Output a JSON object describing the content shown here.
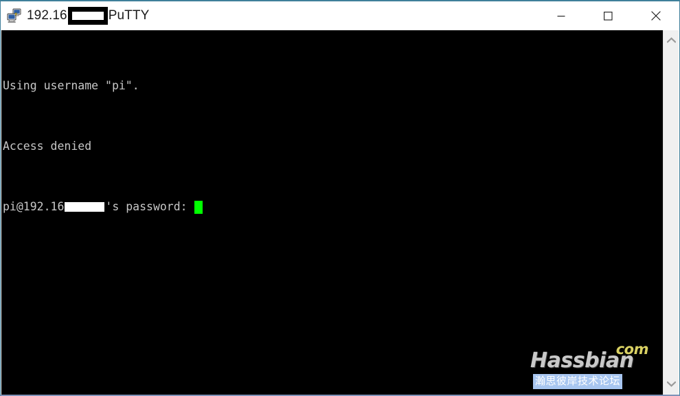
{
  "window": {
    "title_prefix": "192.16",
    "title_redacted": true,
    "title_suffix": "PuTTY",
    "app_icon_name": "putty-computers-icon",
    "frame_top_color": "#3f7f9a",
    "frame_bottom_color": "#7f92b8"
  },
  "window_controls": {
    "minimize_label": "Minimize",
    "maximize_label": "Maximize",
    "close_label": "Close"
  },
  "terminal": {
    "background": "#000000",
    "foreground": "#c8c8c8",
    "cursor_color": "#00ff00",
    "lines": [
      {
        "segments": [
          {
            "type": "text",
            "value": "Using username \"pi\"."
          }
        ]
      },
      {
        "segments": [
          {
            "type": "text",
            "value": "Access denied"
          }
        ]
      },
      {
        "segments": [
          {
            "type": "text",
            "value": "pi@192.16"
          },
          {
            "type": "redaction"
          },
          {
            "type": "text",
            "value": "'s password: "
          },
          {
            "type": "cursor"
          }
        ]
      }
    ],
    "line1": "Using username \"pi\".",
    "line2": "Access denied",
    "line3_prefix": "pi@192.16",
    "line3_suffix": "'s password: "
  },
  "watermark": {
    "com_text": "com",
    "com_color": "#d9d163",
    "name_text": "Hassbian",
    "name_color": "#c9c9c9",
    "cn_text": "瀚思彼岸技术论坛",
    "cn_background": "#a8c6f0"
  },
  "scrollbar": {
    "up_arrow_name": "chevron-up-icon",
    "down_arrow_name": "chevron-down-icon",
    "track_color": "#f0f0f0"
  }
}
